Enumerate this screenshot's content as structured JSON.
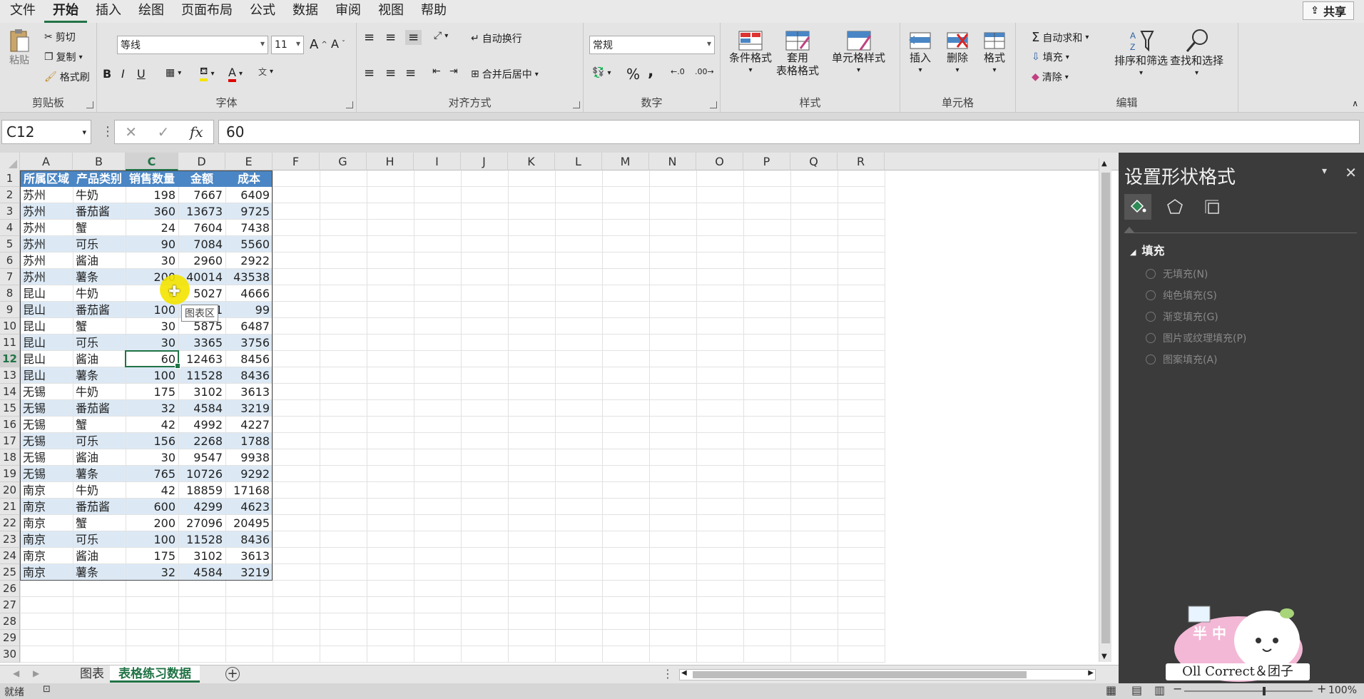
{
  "menu": {
    "items": [
      "文件",
      "开始",
      "插入",
      "绘图",
      "页面布局",
      "公式",
      "数据",
      "审阅",
      "视图",
      "帮助"
    ],
    "active_index": 1,
    "share_label": "共享"
  },
  "ribbon": {
    "clipboard": {
      "paste": "粘贴",
      "cut": "剪切",
      "copy": "复制",
      "format_painter": "格式刷",
      "group": "剪贴板"
    },
    "font": {
      "name": "等线",
      "size": "11",
      "bold": "B",
      "italic": "I",
      "underline": "U",
      "group": "字体"
    },
    "alignment": {
      "wrap": "自动换行",
      "merge": "合并后居中",
      "group": "对齐方式"
    },
    "number": {
      "format": "常规",
      "percent": "%",
      "comma": ",",
      "group": "数字"
    },
    "styles": {
      "conditional": "条件格式",
      "table1": "套用",
      "table2": "表格格式",
      "cell_styles": "单元格样式",
      "group": "样式"
    },
    "cells": {
      "insert": "插入",
      "delete": "删除",
      "format": "格式",
      "group": "单元格"
    },
    "editing": {
      "autosum": "自动求和",
      "fill": "填充",
      "clear": "清除",
      "sort": "排序和筛选",
      "find": "查找和选择",
      "group": "编辑"
    }
  },
  "formula_bar": {
    "name_box": "C12",
    "content": "60",
    "cancel": "✕",
    "enter": "✓",
    "fx": "fx"
  },
  "columns": [
    "A",
    "B",
    "C",
    "D",
    "E",
    "F",
    "G",
    "H",
    "I",
    "J",
    "K",
    "L",
    "M",
    "N",
    "O",
    "P",
    "Q",
    "R"
  ],
  "selected_column": "C",
  "selected_row": 12,
  "table": {
    "headers": [
      "所属区域",
      "产品类别",
      "销售数量",
      "金额",
      "成本"
    ],
    "rows": [
      [
        "苏州",
        "牛奶",
        "198",
        "7667",
        "6409"
      ],
      [
        "苏州",
        "番茄酱",
        "360",
        "13673",
        "9725"
      ],
      [
        "苏州",
        "蟹",
        "24",
        "7604",
        "7438"
      ],
      [
        "苏州",
        "可乐",
        "90",
        "7084",
        "5560"
      ],
      [
        "苏州",
        "酱油",
        "30",
        "2960",
        "2922"
      ],
      [
        "苏州",
        "薯条",
        "200",
        "40014",
        "43538"
      ],
      [
        "昆山",
        "牛奶",
        "8",
        "5027",
        "4666"
      ],
      [
        "昆山",
        "番茄酱",
        "100",
        "111",
        "99"
      ],
      [
        "昆山",
        "蟹",
        "30",
        "5875",
        "6487"
      ],
      [
        "昆山",
        "可乐",
        "30",
        "3365",
        "3756"
      ],
      [
        "昆山",
        "酱油",
        "60",
        "12463",
        "8456"
      ],
      [
        "昆山",
        "薯条",
        "100",
        "11528",
        "8436"
      ],
      [
        "无锡",
        "牛奶",
        "175",
        "3102",
        "3613"
      ],
      [
        "无锡",
        "番茄酱",
        "32",
        "4584",
        "3219"
      ],
      [
        "无锡",
        "蟹",
        "42",
        "4992",
        "4227"
      ],
      [
        "无锡",
        "可乐",
        "156",
        "2268",
        "1788"
      ],
      [
        "无锡",
        "酱油",
        "30",
        "9547",
        "9938"
      ],
      [
        "无锡",
        "薯条",
        "765",
        "10726",
        "9292"
      ],
      [
        "南京",
        "牛奶",
        "42",
        "18859",
        "17168"
      ],
      [
        "南京",
        "番茄酱",
        "600",
        "4299",
        "4623"
      ],
      [
        "南京",
        "蟹",
        "200",
        "27096",
        "20495"
      ],
      [
        "南京",
        "可乐",
        "100",
        "11528",
        "8436"
      ],
      [
        "南京",
        "酱油",
        "175",
        "3102",
        "3613"
      ],
      [
        "南京",
        "薯条",
        "32",
        "4584",
        "3219"
      ]
    ]
  },
  "total_rows": 30,
  "tooltip": "图表区",
  "sheets": {
    "tabs": [
      "图表",
      "表格练习数据"
    ],
    "active_index": 1,
    "add": "+"
  },
  "status": {
    "ready": "就绪",
    "zoom": "100%"
  },
  "pane": {
    "title": "设置形状格式",
    "section": "填充",
    "options": [
      "无填充(N)",
      "纯色填充(S)",
      "渐变填充(G)",
      "图片或纹理填充(P)",
      "图案填充(A)"
    ]
  },
  "watermark": {
    "text": "Oll Correct＆团子",
    "badge": "半 中"
  },
  "colors": {
    "accent": "#217346",
    "table_header": "#4a86c5",
    "table_band": "#dce9f5",
    "pane_bg": "#3b3b3b"
  }
}
